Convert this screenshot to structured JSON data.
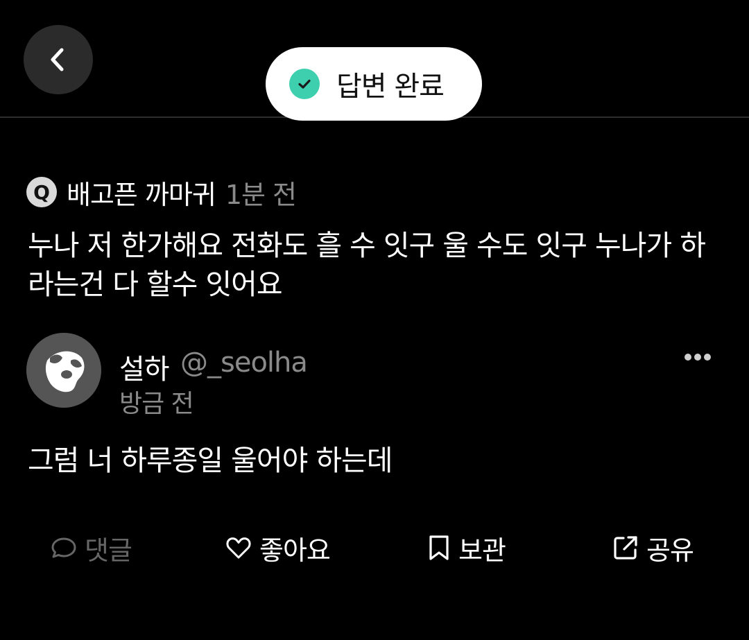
{
  "header": {
    "back_icon": "chevron-left-icon",
    "status": {
      "icon": "check-circle-icon",
      "label": "답변 완료",
      "check_color": "#3ecfae"
    }
  },
  "question": {
    "badge": "Q",
    "author": "배고픈 까마귀",
    "time": "1분 전",
    "text": "누나 저 한가해요 전화도 흘 수 잇구 울 수도 잇구 누나가 하라는건 다 할수 잇어요"
  },
  "answer": {
    "name": "설하",
    "handle": "@_seolha",
    "time": "방금 전",
    "text": "그럼 너 하루종일 울어야 하는데",
    "more_icon": "more-horizontal-icon"
  },
  "actions": {
    "comment": "댓글",
    "like": "좋아요",
    "save": "보관",
    "share": "공유"
  }
}
